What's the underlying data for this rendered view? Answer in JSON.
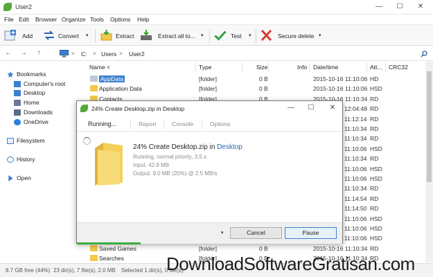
{
  "window": {
    "title": "User2",
    "minimize": "—",
    "maximize": "☐",
    "close": "✕"
  },
  "menu": [
    "File",
    "Edit",
    "Browser",
    "Organize",
    "Tools",
    "Options",
    "Help"
  ],
  "toolbar": {
    "add": "Add",
    "convert": "Convert",
    "extract": "Extract",
    "extract_all": "Extract all to...",
    "test": "Test",
    "secure_delete": "Secure delete",
    "dropdown": "▾"
  },
  "address": {
    "drive": "C:",
    "crumbs": [
      "Users",
      "User2"
    ],
    "sep": ">"
  },
  "sidebar": {
    "bookmarks": "Bookmarks",
    "items": [
      "Computer's root",
      "Desktop",
      "Home",
      "Downloads",
      "OneDrive"
    ],
    "filesystem": "Filesystem",
    "history": "History",
    "open": "Open"
  },
  "columns": [
    "Name <",
    "Type",
    "Size",
    "Info",
    "Date/time",
    "Att...",
    "CRC32"
  ],
  "rows": [
    {
      "name": "AppData",
      "type": "[folder]",
      "size": "0 B",
      "date": "2015-10-16 11:10:06",
      "attr": "HD"
    },
    {
      "name": "Application Data",
      "type": "[folder]",
      "size": "0 B",
      "date": "2015-10-16 11:10:06",
      "attr": "HSD"
    },
    {
      "name": "Contacts",
      "type": "[folder]",
      "size": "0 B",
      "date": "2015-10-16 11:10:34",
      "attr": "RD"
    },
    {
      "name": "",
      "type": "",
      "size": "",
      "date": "12:04:48",
      "attr": "RD"
    },
    {
      "name": "",
      "type": "",
      "size": "",
      "date": "11:12:14",
      "attr": "RD"
    },
    {
      "name": "",
      "type": "",
      "size": "",
      "date": "11:10:34",
      "attr": "RD"
    },
    {
      "name": "",
      "type": "",
      "size": "",
      "date": "11:10:34",
      "attr": "RD"
    },
    {
      "name": "",
      "type": "",
      "size": "",
      "date": "11:10:06",
      "attr": "HSD"
    },
    {
      "name": "",
      "type": "",
      "size": "",
      "date": "11:10:34",
      "attr": "RD"
    },
    {
      "name": "",
      "type": "",
      "size": "",
      "date": "11:10:06",
      "attr": "HSD"
    },
    {
      "name": "",
      "type": "",
      "size": "",
      "date": "11:10:06",
      "attr": "HSD"
    },
    {
      "name": "",
      "type": "",
      "size": "",
      "date": "11:10:34",
      "attr": "RD"
    },
    {
      "name": "",
      "type": "",
      "size": "",
      "date": "11:14:54",
      "attr": "RD"
    },
    {
      "name": "",
      "type": "",
      "size": "",
      "date": "11:14:50",
      "attr": "RD"
    },
    {
      "name": "",
      "type": "",
      "size": "",
      "date": "11:10:06",
      "attr": "HSD"
    },
    {
      "name": "",
      "type": "",
      "size": "",
      "date": "11:10:06",
      "attr": "HSD"
    },
    {
      "name": "",
      "type": "",
      "size": "",
      "date": "11:10:06",
      "attr": "HSD"
    },
    {
      "name": "Saved Games",
      "type": "[folder]",
      "size": "0 B",
      "date": "2015-10-16 11:10:34",
      "attr": "RD"
    },
    {
      "name": "Searches",
      "type": "[folder]",
      "size": "0 B",
      "date": "2015-10-16 11:10:34",
      "attr": "RD"
    }
  ],
  "status": {
    "free": "8.7 GB free (44%)",
    "counts": "23 dir(s), 7 file(s), 2.0 MB",
    "selected": "Selected 1 dir(s), 0 file(s),"
  },
  "watermark": "DownloadSoftwareGratisan.com",
  "dialog": {
    "title": "24% Create Desktop.zip in Desktop",
    "minimize": "—",
    "maximize": "☐",
    "close": "✕",
    "tabs": [
      "Running...",
      "Report",
      "Console",
      "Options"
    ],
    "op_title": "24% Create Desktop.zip in",
    "op_target": "Desktop",
    "status_line": "Running, normal priority, 3.5 s",
    "input_line": "Input: 42.9 MB",
    "output_line": "Output: 9.0 MB (20%) @ 2.5 MB/s",
    "dropdown": "▾",
    "cancel": "Cancel",
    "pause": "Pause",
    "progress": 0.24
  },
  "colors": {
    "accent": "#3c7fd1",
    "progress": "#3cae3c",
    "folder": "#f3c94a",
    "link": "#2b66b4"
  }
}
